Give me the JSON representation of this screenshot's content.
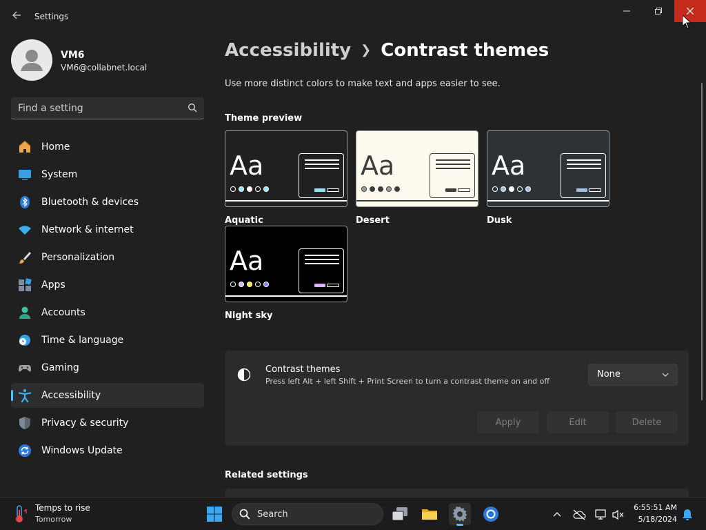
{
  "window": {
    "title": "Settings"
  },
  "user": {
    "name": "VM6",
    "email": "VM6@collabnet.local"
  },
  "search": {
    "placeholder": "Find a setting"
  },
  "nav": {
    "items": [
      {
        "label": "Home"
      },
      {
        "label": "System"
      },
      {
        "label": "Bluetooth & devices"
      },
      {
        "label": "Network & internet"
      },
      {
        "label": "Personalization"
      },
      {
        "label": "Apps"
      },
      {
        "label": "Accounts"
      },
      {
        "label": "Time & language"
      },
      {
        "label": "Gaming"
      },
      {
        "label": "Accessibility",
        "selected": true
      },
      {
        "label": "Privacy & security"
      },
      {
        "label": "Windows Update"
      }
    ]
  },
  "breadcrumb": {
    "parent": "Accessibility",
    "current": "Contrast themes"
  },
  "description": "Use more distinct colors to make text and apps easier to see.",
  "theme_preview": {
    "heading": "Theme preview",
    "themes": [
      {
        "name": "Aquatic",
        "bg": "#202020",
        "fg": "#ffffff",
        "dots": [
          "#202020",
          "#8ee3f5",
          "#ffffff",
          "#202020",
          "#8ee3f5"
        ],
        "accent": "#8ee3f5"
      },
      {
        "name": "Desert",
        "bg": "#fffaef",
        "fg": "#3d3d3d",
        "dots": [
          "#a0a0a0",
          "#3d3d3d",
          "#3d3d3d",
          "#a0a0a0",
          "#3d3d3d"
        ],
        "accent": "#3d3d3d"
      },
      {
        "name": "Dusk",
        "bg": "#2d3236",
        "fg": "#ffffff",
        "dots": [
          "#2d3236",
          "#a1bfde",
          "#ffffff",
          "#2d3236",
          "#a1bfde"
        ],
        "accent": "#a1bfde"
      },
      {
        "name": "Night sky",
        "bg": "#000000",
        "fg": "#ffffff",
        "dots": [
          "#000000",
          "#d6b4fd",
          "#ffee32",
          "#000000",
          "#8080ff"
        ],
        "accent": "#d6b4fd"
      }
    ]
  },
  "contrast_card": {
    "title": "Contrast themes",
    "subtitle": "Press left Alt + left Shift + Print Screen to turn a contrast theme on and off",
    "selected": "None",
    "buttons": {
      "apply": "Apply",
      "edit": "Edit",
      "delete": "Delete"
    }
  },
  "related": {
    "heading": "Related settings"
  },
  "taskbar": {
    "weather": {
      "title": "Temps to rise",
      "subtitle": "Tomorrow"
    },
    "search_label": "Search",
    "clock": {
      "time": "6:55:51 AM",
      "date": "5/18/2024"
    }
  },
  "colors": {
    "accent": "#4cc2ff",
    "close": "#c42b1c",
    "background": "#202020"
  }
}
